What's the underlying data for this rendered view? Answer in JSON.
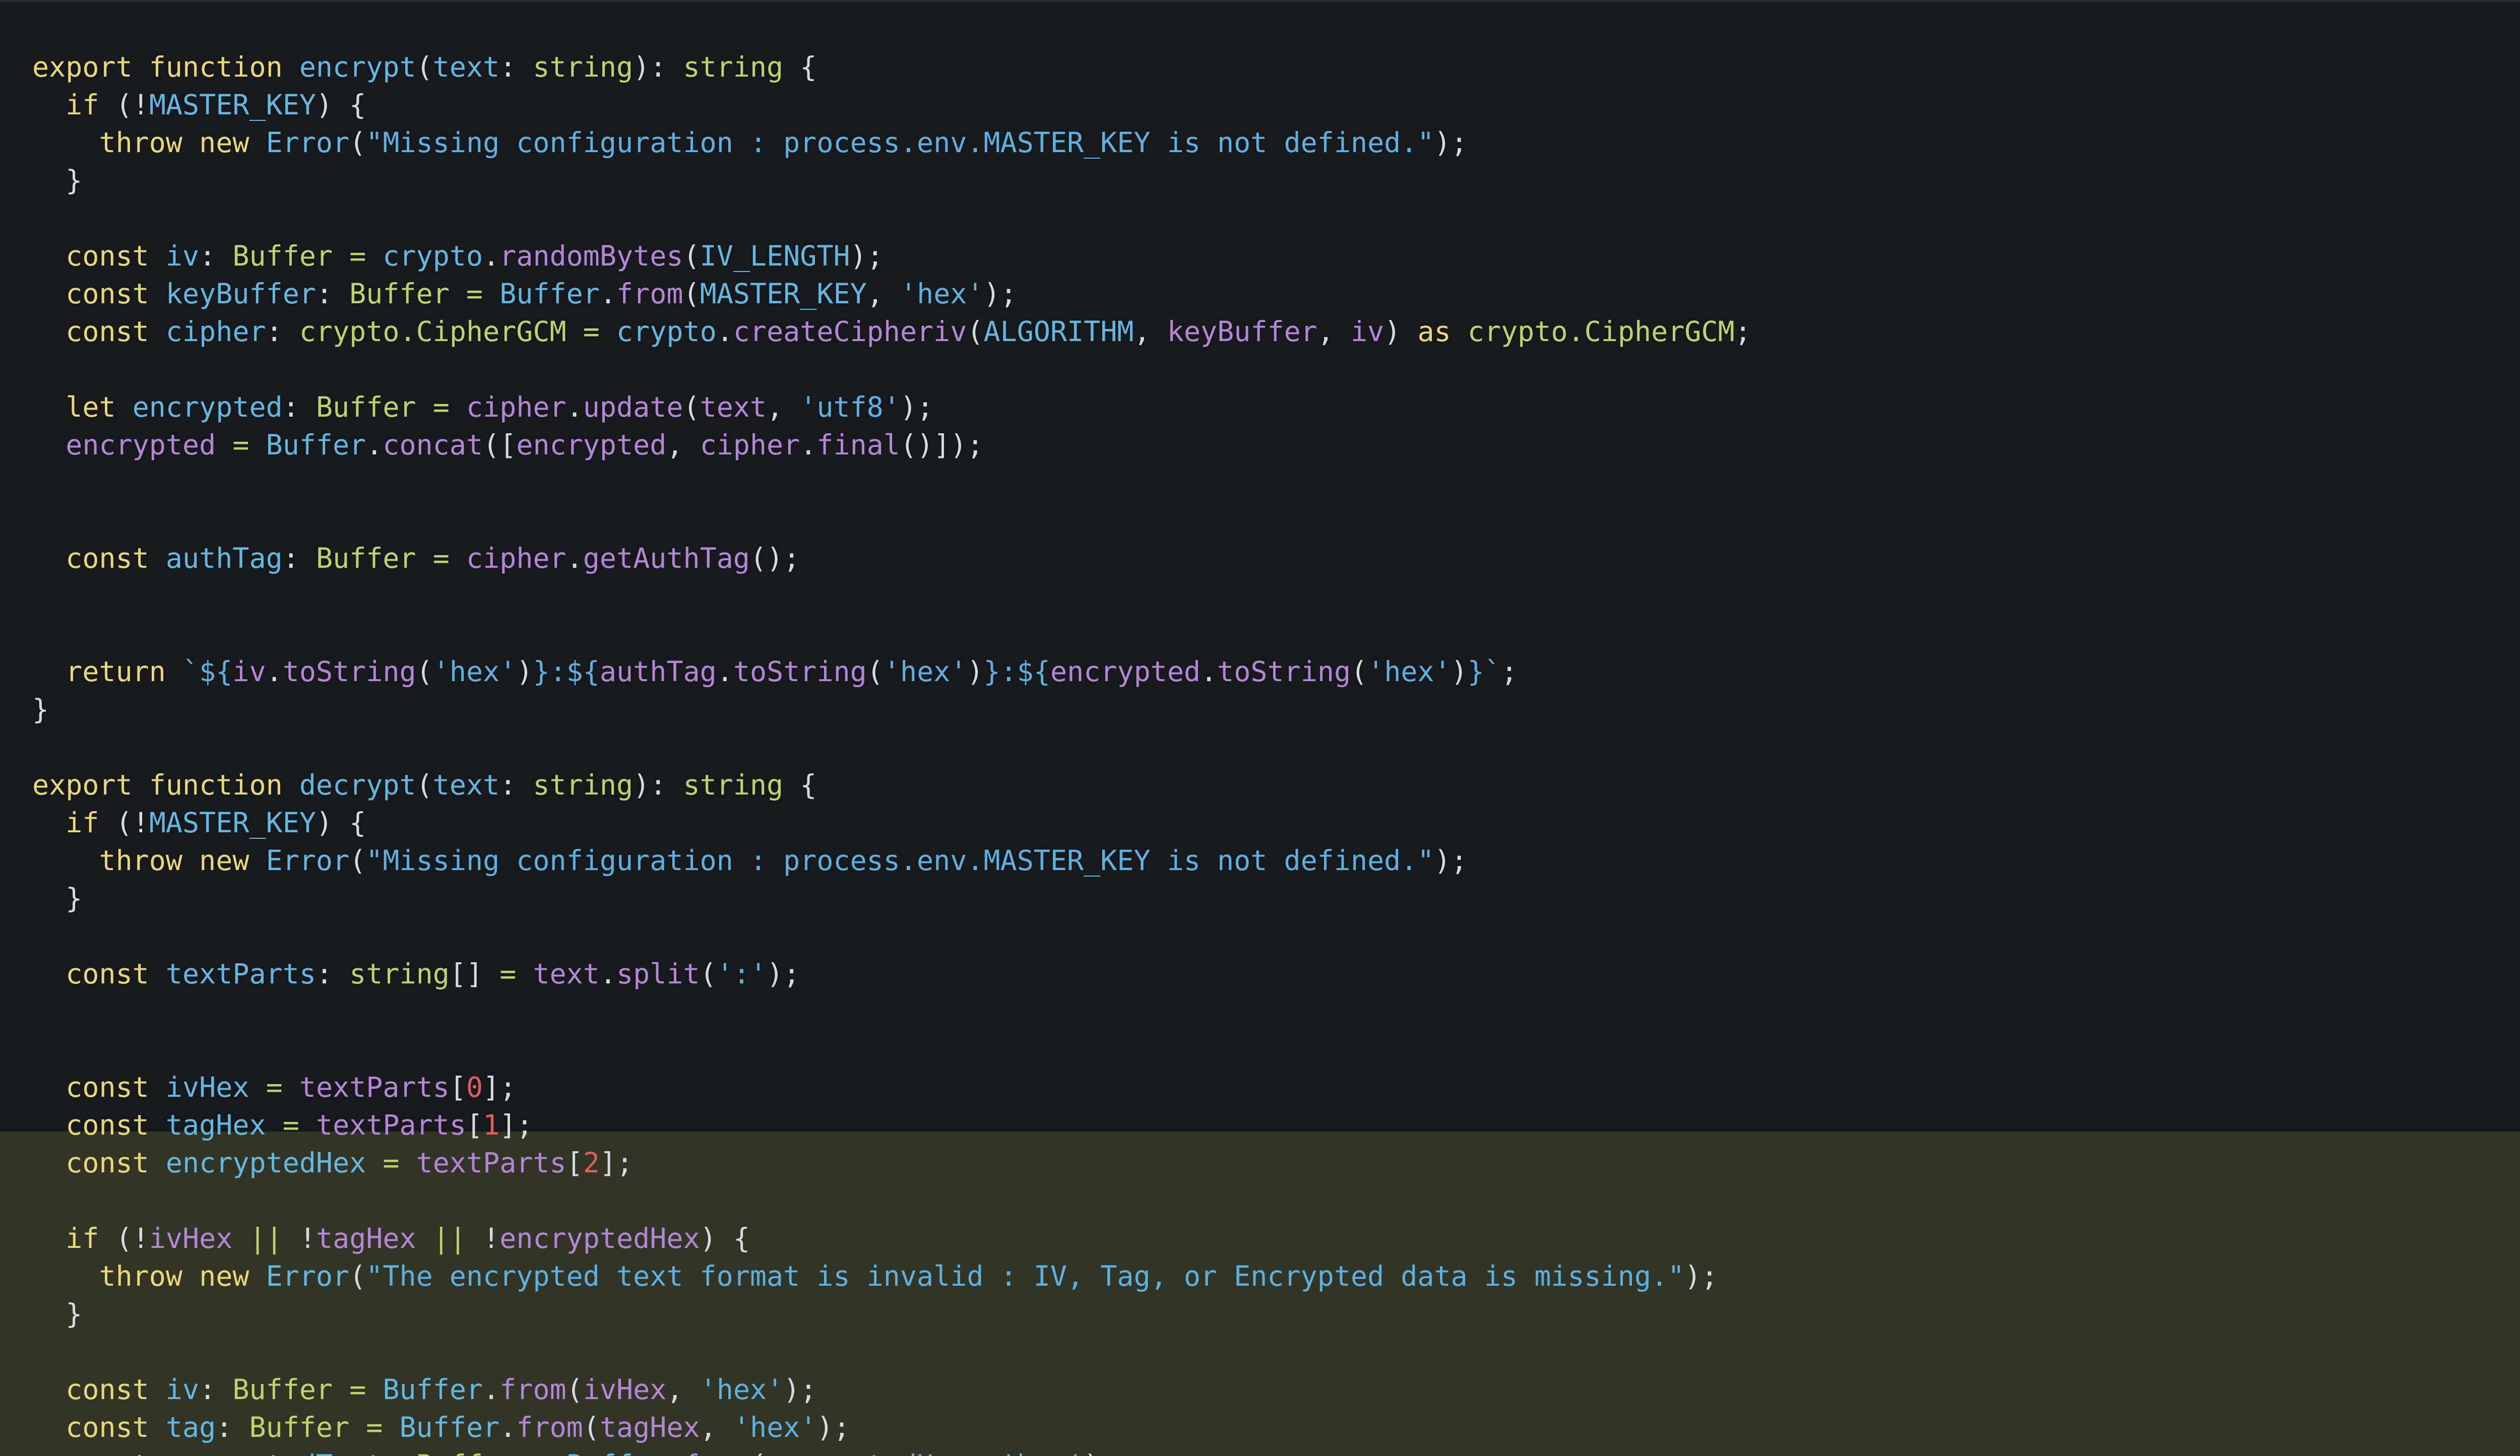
{
  "editor": {
    "language": "typescript",
    "colors": {
      "background": "#16181b",
      "highlight_band": "#323426",
      "keyword": "#e8d879",
      "function": "#62b8e0",
      "type": "#bcd46c",
      "variable": "#b387d6",
      "punctuation": "#d7dae0",
      "string": "#5db1e0",
      "number": "#e05d5d"
    },
    "lines": [
      [
        [
          "kw",
          "export function "
        ],
        [
          "fn",
          "encrypt"
        ],
        [
          "pu",
          "("
        ],
        [
          "fn",
          "text"
        ],
        [
          "pu",
          ": "
        ],
        [
          "ty",
          "string"
        ],
        [
          "pu",
          "): "
        ],
        [
          "ty",
          "string"
        ],
        [
          "pu",
          " {"
        ]
      ],
      [
        [
          "pu",
          "  "
        ],
        [
          "kw",
          "if "
        ],
        [
          "pu",
          "(!"
        ],
        [
          "fn",
          "MASTER_KEY"
        ],
        [
          "pu",
          ") {"
        ]
      ],
      [
        [
          "pu",
          "    "
        ],
        [
          "kw",
          "throw new "
        ],
        [
          "fn",
          "Error"
        ],
        [
          "pu",
          "("
        ],
        [
          "st",
          "\"Missing configuration : process.env.MASTER_KEY is not defined.\""
        ],
        [
          "pu",
          ");"
        ]
      ],
      [
        [
          "pu",
          "  }"
        ]
      ],
      [],
      [
        [
          "pu",
          "  "
        ],
        [
          "kw",
          "const "
        ],
        [
          "fn",
          "iv"
        ],
        [
          "pu",
          ": "
        ],
        [
          "ty",
          "Buffer"
        ],
        [
          "op",
          " = "
        ],
        [
          "fn",
          "crypto"
        ],
        [
          "pu",
          "."
        ],
        [
          "va",
          "randomBytes"
        ],
        [
          "pu",
          "("
        ],
        [
          "fn",
          "IV_LENGTH"
        ],
        [
          "pu",
          ");"
        ]
      ],
      [
        [
          "pu",
          "  "
        ],
        [
          "kw",
          "const "
        ],
        [
          "fn",
          "keyBuffer"
        ],
        [
          "pu",
          ": "
        ],
        [
          "ty",
          "Buffer"
        ],
        [
          "op",
          " = "
        ],
        [
          "fn",
          "Buffer"
        ],
        [
          "pu",
          "."
        ],
        [
          "va",
          "from"
        ],
        [
          "pu",
          "("
        ],
        [
          "fn",
          "MASTER_KEY"
        ],
        [
          "pu",
          ", "
        ],
        [
          "st",
          "'hex'"
        ],
        [
          "pu",
          ");"
        ]
      ],
      [
        [
          "pu",
          "  "
        ],
        [
          "kw",
          "const "
        ],
        [
          "fn",
          "cipher"
        ],
        [
          "pu",
          ": "
        ],
        [
          "ty",
          "crypto.CipherGCM"
        ],
        [
          "op",
          " = "
        ],
        [
          "fn",
          "crypto"
        ],
        [
          "pu",
          "."
        ],
        [
          "va",
          "createCipheriv"
        ],
        [
          "pu",
          "("
        ],
        [
          "fn",
          "ALGORITHM"
        ],
        [
          "pu",
          ", "
        ],
        [
          "va",
          "keyBuffer"
        ],
        [
          "pu",
          ", "
        ],
        [
          "va",
          "iv"
        ],
        [
          "pu",
          ") "
        ],
        [
          "kw",
          "as "
        ],
        [
          "ty",
          "crypto.CipherGCM"
        ],
        [
          "pu",
          ";"
        ]
      ],
      [],
      [
        [
          "pu",
          "  "
        ],
        [
          "kw",
          "let "
        ],
        [
          "fn",
          "encrypted"
        ],
        [
          "pu",
          ": "
        ],
        [
          "ty",
          "Buffer"
        ],
        [
          "op",
          " = "
        ],
        [
          "va",
          "cipher"
        ],
        [
          "pu",
          "."
        ],
        [
          "va",
          "update"
        ],
        [
          "pu",
          "("
        ],
        [
          "va",
          "text"
        ],
        [
          "pu",
          ", "
        ],
        [
          "st",
          "'utf8'"
        ],
        [
          "pu",
          ");"
        ]
      ],
      [
        [
          "pu",
          "  "
        ],
        [
          "va",
          "encrypted"
        ],
        [
          "op",
          " = "
        ],
        [
          "fn",
          "Buffer"
        ],
        [
          "pu",
          "."
        ],
        [
          "va",
          "concat"
        ],
        [
          "pu",
          "(["
        ],
        [
          "va",
          "encrypted"
        ],
        [
          "pu",
          ", "
        ],
        [
          "va",
          "cipher"
        ],
        [
          "pu",
          "."
        ],
        [
          "va",
          "final"
        ],
        [
          "pu",
          "()]);"
        ]
      ],
      [],
      [],
      [
        [
          "pu",
          "  "
        ],
        [
          "kw",
          "const "
        ],
        [
          "fn",
          "authTag"
        ],
        [
          "pu",
          ": "
        ],
        [
          "ty",
          "Buffer"
        ],
        [
          "op",
          " = "
        ],
        [
          "va",
          "cipher"
        ],
        [
          "pu",
          "."
        ],
        [
          "va",
          "getAuthTag"
        ],
        [
          "pu",
          "();"
        ]
      ],
      [],
      [],
      [
        [
          "pu",
          "  "
        ],
        [
          "kw",
          "return "
        ],
        [
          "st",
          "`${"
        ],
        [
          "va",
          "iv"
        ],
        [
          "pu",
          "."
        ],
        [
          "va",
          "toString"
        ],
        [
          "pu",
          "("
        ],
        [
          "st",
          "'hex'"
        ],
        [
          "pu",
          ")"
        ],
        [
          "st",
          "}:${"
        ],
        [
          "va",
          "authTag"
        ],
        [
          "pu",
          "."
        ],
        [
          "va",
          "toString"
        ],
        [
          "pu",
          "("
        ],
        [
          "st",
          "'hex'"
        ],
        [
          "pu",
          ")"
        ],
        [
          "st",
          "}:${"
        ],
        [
          "va",
          "encrypted"
        ],
        [
          "pu",
          "."
        ],
        [
          "va",
          "toString"
        ],
        [
          "pu",
          "("
        ],
        [
          "st",
          "'hex'"
        ],
        [
          "pu",
          ")"
        ],
        [
          "st",
          "}`"
        ],
        [
          "pu",
          ";"
        ]
      ],
      [
        [
          "pu",
          "}"
        ]
      ],
      [],
      [
        [
          "kw",
          "export function "
        ],
        [
          "fn",
          "decrypt"
        ],
        [
          "pu",
          "("
        ],
        [
          "fn",
          "text"
        ],
        [
          "pu",
          ": "
        ],
        [
          "ty",
          "string"
        ],
        [
          "pu",
          "): "
        ],
        [
          "ty",
          "string"
        ],
        [
          "pu",
          " {"
        ]
      ],
      [
        [
          "pu",
          "  "
        ],
        [
          "kw",
          "if "
        ],
        [
          "pu",
          "(!"
        ],
        [
          "fn",
          "MASTER_KEY"
        ],
        [
          "pu",
          ") {"
        ]
      ],
      [
        [
          "pu",
          "    "
        ],
        [
          "kw",
          "throw new "
        ],
        [
          "fn",
          "Error"
        ],
        [
          "pu",
          "("
        ],
        [
          "st",
          "\"Missing configuration : process.env.MASTER_KEY is not defined.\""
        ],
        [
          "pu",
          ");"
        ]
      ],
      [
        [
          "pu",
          "  }"
        ]
      ],
      [],
      [
        [
          "pu",
          "  "
        ],
        [
          "kw",
          "const "
        ],
        [
          "fn",
          "textParts"
        ],
        [
          "pu",
          ": "
        ],
        [
          "ty",
          "string"
        ],
        [
          "pu",
          "[] "
        ],
        [
          "op",
          "= "
        ],
        [
          "va",
          "text"
        ],
        [
          "pu",
          "."
        ],
        [
          "va",
          "split"
        ],
        [
          "pu",
          "("
        ],
        [
          "st",
          "':'"
        ],
        [
          "pu",
          ");"
        ]
      ],
      [],
      [],
      [
        [
          "pu",
          "  "
        ],
        [
          "kw",
          "const "
        ],
        [
          "fn",
          "ivHex"
        ],
        [
          "op",
          " = "
        ],
        [
          "va",
          "textParts"
        ],
        [
          "pu",
          "["
        ],
        [
          "nu",
          "0"
        ],
        [
          "pu",
          "];"
        ]
      ],
      [
        [
          "pu",
          "  "
        ],
        [
          "kw",
          "const "
        ],
        [
          "fn",
          "tagHex"
        ],
        [
          "op",
          " = "
        ],
        [
          "va",
          "textParts"
        ],
        [
          "pu",
          "["
        ],
        [
          "nu",
          "1"
        ],
        [
          "pu",
          "];"
        ]
      ],
      [
        [
          "pu",
          "  "
        ],
        [
          "kw",
          "const "
        ],
        [
          "fn",
          "encryptedHex"
        ],
        [
          "op",
          " = "
        ],
        [
          "va",
          "textParts"
        ],
        [
          "pu",
          "["
        ],
        [
          "nu",
          "2"
        ],
        [
          "pu",
          "];"
        ]
      ],
      [],
      [
        [
          "pu",
          "  "
        ],
        [
          "kw",
          "if "
        ],
        [
          "pu",
          "(!"
        ],
        [
          "va",
          "ivHex"
        ],
        [
          "op",
          " || "
        ],
        [
          "pu",
          "!"
        ],
        [
          "va",
          "tagHex"
        ],
        [
          "op",
          " || "
        ],
        [
          "pu",
          "!"
        ],
        [
          "va",
          "encryptedHex"
        ],
        [
          "pu",
          ") {"
        ]
      ],
      [
        [
          "pu",
          "    "
        ],
        [
          "kw",
          "throw new "
        ],
        [
          "fn",
          "Error"
        ],
        [
          "pu",
          "("
        ],
        [
          "st",
          "\"The encrypted text format is invalid : IV, Tag, or Encrypted data is missing.\""
        ],
        [
          "pu",
          ");"
        ]
      ],
      [
        [
          "pu",
          "  }"
        ]
      ],
      [],
      [
        [
          "pu",
          "  "
        ],
        [
          "kw",
          "const "
        ],
        [
          "fn",
          "iv"
        ],
        [
          "pu",
          ": "
        ],
        [
          "ty",
          "Buffer"
        ],
        [
          "op",
          " = "
        ],
        [
          "fn",
          "Buffer"
        ],
        [
          "pu",
          "."
        ],
        [
          "va",
          "from"
        ],
        [
          "pu",
          "("
        ],
        [
          "va",
          "ivHex"
        ],
        [
          "pu",
          ", "
        ],
        [
          "st",
          "'hex'"
        ],
        [
          "pu",
          ");"
        ]
      ],
      [
        [
          "pu",
          "  "
        ],
        [
          "kw",
          "const "
        ],
        [
          "fn",
          "tag"
        ],
        [
          "pu",
          ": "
        ],
        [
          "ty",
          "Buffer"
        ],
        [
          "op",
          " = "
        ],
        [
          "fn",
          "Buffer"
        ],
        [
          "pu",
          "."
        ],
        [
          "va",
          "from"
        ],
        [
          "pu",
          "("
        ],
        [
          "va",
          "tagHex"
        ],
        [
          "pu",
          ", "
        ],
        [
          "st",
          "'hex'"
        ],
        [
          "pu",
          ");"
        ]
      ],
      [
        [
          "pu",
          "  "
        ],
        [
          "kw",
          "const "
        ],
        [
          "fn",
          "encryptedText"
        ],
        [
          "pu",
          ": "
        ],
        [
          "ty",
          "Buffer"
        ],
        [
          "op",
          " = "
        ],
        [
          "fn",
          "Buffer"
        ],
        [
          "pu",
          "."
        ],
        [
          "va",
          "from"
        ],
        [
          "pu",
          "("
        ],
        [
          "va",
          "encryptedHex"
        ],
        [
          "pu",
          ", "
        ],
        [
          "st",
          "'hex'"
        ],
        [
          "pu",
          ");"
        ]
      ]
    ]
  }
}
